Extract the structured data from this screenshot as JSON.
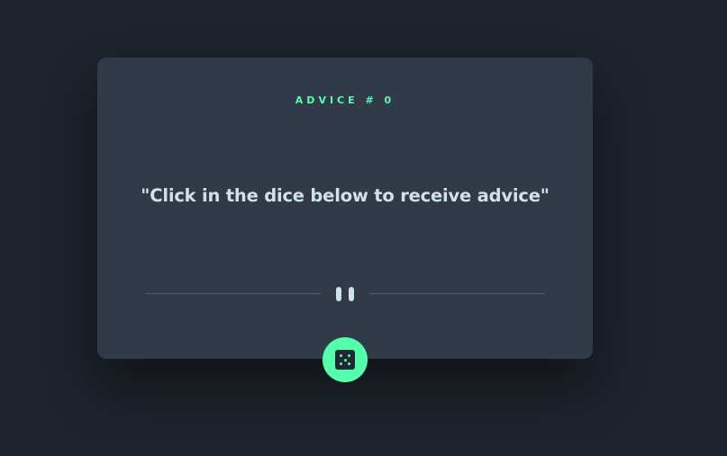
{
  "advice": {
    "label": "ADVICE",
    "id_prefix": "#",
    "id_value": "0",
    "quote": "\"Click in the dice below to receive advice\""
  },
  "icons": {
    "divider": "pause-icon",
    "dice": "dice-icon"
  },
  "colors": {
    "background": "#1e232c",
    "card": "#313a49",
    "accent": "#53ffaa",
    "text": "#cee3e9",
    "divider": "#4f5d74"
  }
}
